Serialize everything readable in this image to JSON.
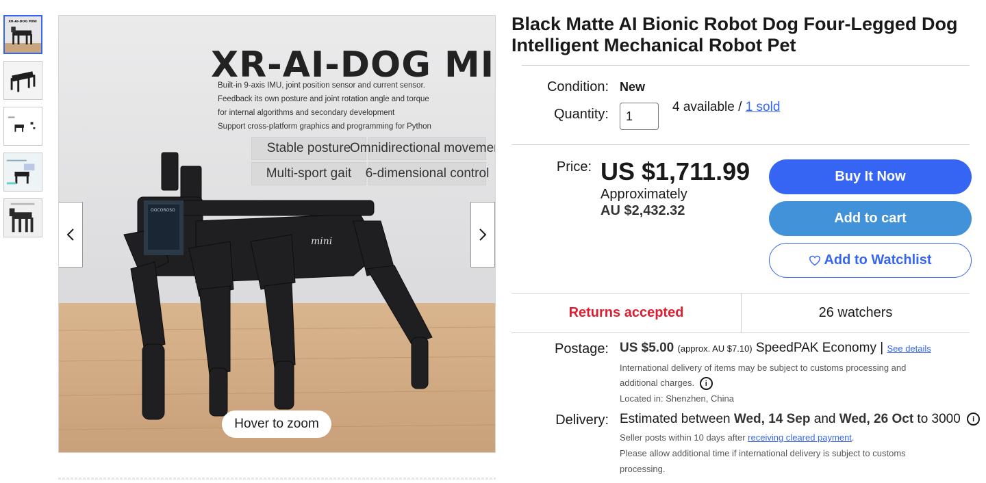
{
  "gallery": {
    "thumbnails": [
      {
        "name": "thumb-1",
        "active": true
      },
      {
        "name": "thumb-2",
        "active": false
      },
      {
        "name": "thumb-3",
        "active": false
      },
      {
        "name": "thumb-4",
        "active": false
      },
      {
        "name": "thumb-5",
        "active": false
      }
    ],
    "thumb1_caption": "XR-AI-DOG MINI",
    "image": {
      "headline": "XR-AI-DOG MINI",
      "description": [
        "Built-in 9-axis IMU, joint position sensor and current sensor.",
        "Feedback its own posture and joint rotation angle and torque",
        "for internal algorithms and secondary development",
        "Support cross-platform graphics and programming for Python"
      ],
      "features": [
        "Stable posture",
        "Omnidirectional movement",
        "Multi-sport gait",
        "6-dimensional control"
      ],
      "robot_label": "mini",
      "screen_text": "OOCOROSO"
    },
    "prev_icon": "chevron-left-icon",
    "next_icon": "chevron-right-icon",
    "hover_zoom": "Hover to zoom"
  },
  "listing": {
    "title": "Black Matte AI Bionic Robot Dog Four-Legged Dog Intelligent Mechanical Robot Pet",
    "condition_label": "Condition:",
    "condition_value": "New",
    "quantity_label": "Quantity:",
    "quantity_value": "1",
    "available": "4 available /",
    "sold": "1 sold",
    "price_label": "Price:",
    "price": "US $1,711.99",
    "approx_label": "Approximately",
    "approx_value": "AU $2,432.32",
    "buttons": {
      "buy": "Buy It Now",
      "cart": "Add to cart",
      "watch": "Add to Watchlist",
      "watch_icon": "heart-icon"
    },
    "returns": "Returns accepted",
    "watchers": "26 watchers",
    "postage_label": "Postage:",
    "postage_amount": "US $5.00",
    "postage_approx": "(approx. AU $7.10)",
    "postage_service": "SpeedPAK Economy |",
    "see_details": "See details",
    "intl_note_1": "International delivery of items may be subject to customs processing and",
    "intl_note_2": "additional charges.",
    "info_icon": "info-icon",
    "located": "Located in: Shenzhen, China",
    "delivery_label": "Delivery:",
    "delivery_prefix": "Estimated between",
    "delivery_start": "Wed, 14 Sep",
    "delivery_and": "and",
    "delivery_end": "Wed, 26 Oct",
    "delivery_to": "to 3000",
    "deliv_note_1": "Seller posts within 10 days after",
    "deliv_note_link": "receiving cleared payment",
    "deliv_note_2": ".",
    "deliv_note_3": "Please allow additional time if international delivery is subject to customs processing."
  },
  "colors": {
    "accent": "#3665f3",
    "returns": "#dd1e31",
    "cart": "#4192d9"
  }
}
